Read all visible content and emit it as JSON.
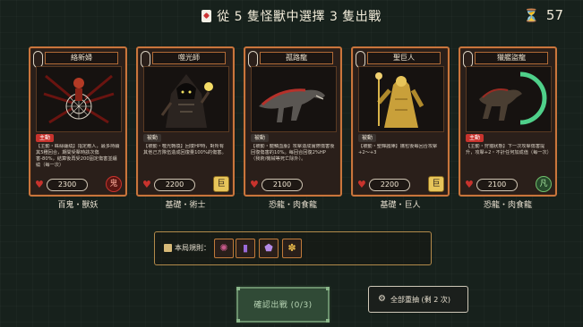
{
  "header": {
    "title": "從 5 隻怪獸中選擇 3 隻出戰",
    "card_icon": "playing-card-icon",
    "timer_icon": "hourglass-icon",
    "timer": "57"
  },
  "cards": [
    {
      "name": "絡新婦",
      "tag": "主動",
      "tag_type": "active",
      "desc": "【主動・蛛絲纏繞】指定敵人，最多持續其5種回合，期間受擊時該次傷害-80%，結算後再受200固定傷害並纏繞（每一次）",
      "hp": "2300",
      "emblem": "鬼",
      "emblem_style": "crimson",
      "caption": "百鬼・獸妖"
    },
    {
      "name": "噬光師",
      "tag": "被動",
      "tag_type": "passive",
      "desc": "【被動・噬光轉換】回復HP時，對所有其他己方隊伍造成回復量100%的傷害。",
      "hp": "2200",
      "emblem": "巨",
      "emblem_style": "gold",
      "caption": "基礎・術士"
    },
    {
      "name": "孤路龍",
      "tag": "被動",
      "tag_type": "passive",
      "desc": "【被動・龍鱗血脈】攻擊造成實際傷害後回復傷害的10%。每回合回復2%HP（我術/機械等死亡除外）。",
      "hp": "2100",
      "emblem": "",
      "emblem_style": "none",
      "caption": "恐龍・肉食龍"
    },
    {
      "name": "聖巨人",
      "tag": "被動",
      "tag_type": "passive",
      "desc": "【被動・聖輝護陣】攜包後每回合攻擊+2～+3",
      "hp": "2200",
      "emblem": "巨",
      "emblem_style": "gold",
      "caption": "基礎・巨人"
    },
    {
      "name": "獵艦盜龍",
      "tag": "主動",
      "tag_type": "active",
      "desc": "【主動・狩獵狀態】下一次攻擊傷害提升，攻擊+2・不計任何加成值（每一次）",
      "hp": "2100",
      "emblem": "凡",
      "emblem_style": "green",
      "caption": "恐龍・肉食龍"
    }
  ],
  "rules": {
    "label": "本局規則：",
    "icons": [
      "beast-rule-icon",
      "shrine-rule-icon",
      "shield-rule-icon",
      "paw-rule-icon"
    ]
  },
  "confirm": {
    "label": "確認出戰 (0/3)"
  },
  "reroll": {
    "label": "全部重抽 (剩 2 次)"
  },
  "colors": {
    "background": "#17211c",
    "card_border": "#c9753c",
    "active_tag": "#c8332d",
    "confirm_bg": "#304a36",
    "rules_border": "#b38a4a"
  }
}
